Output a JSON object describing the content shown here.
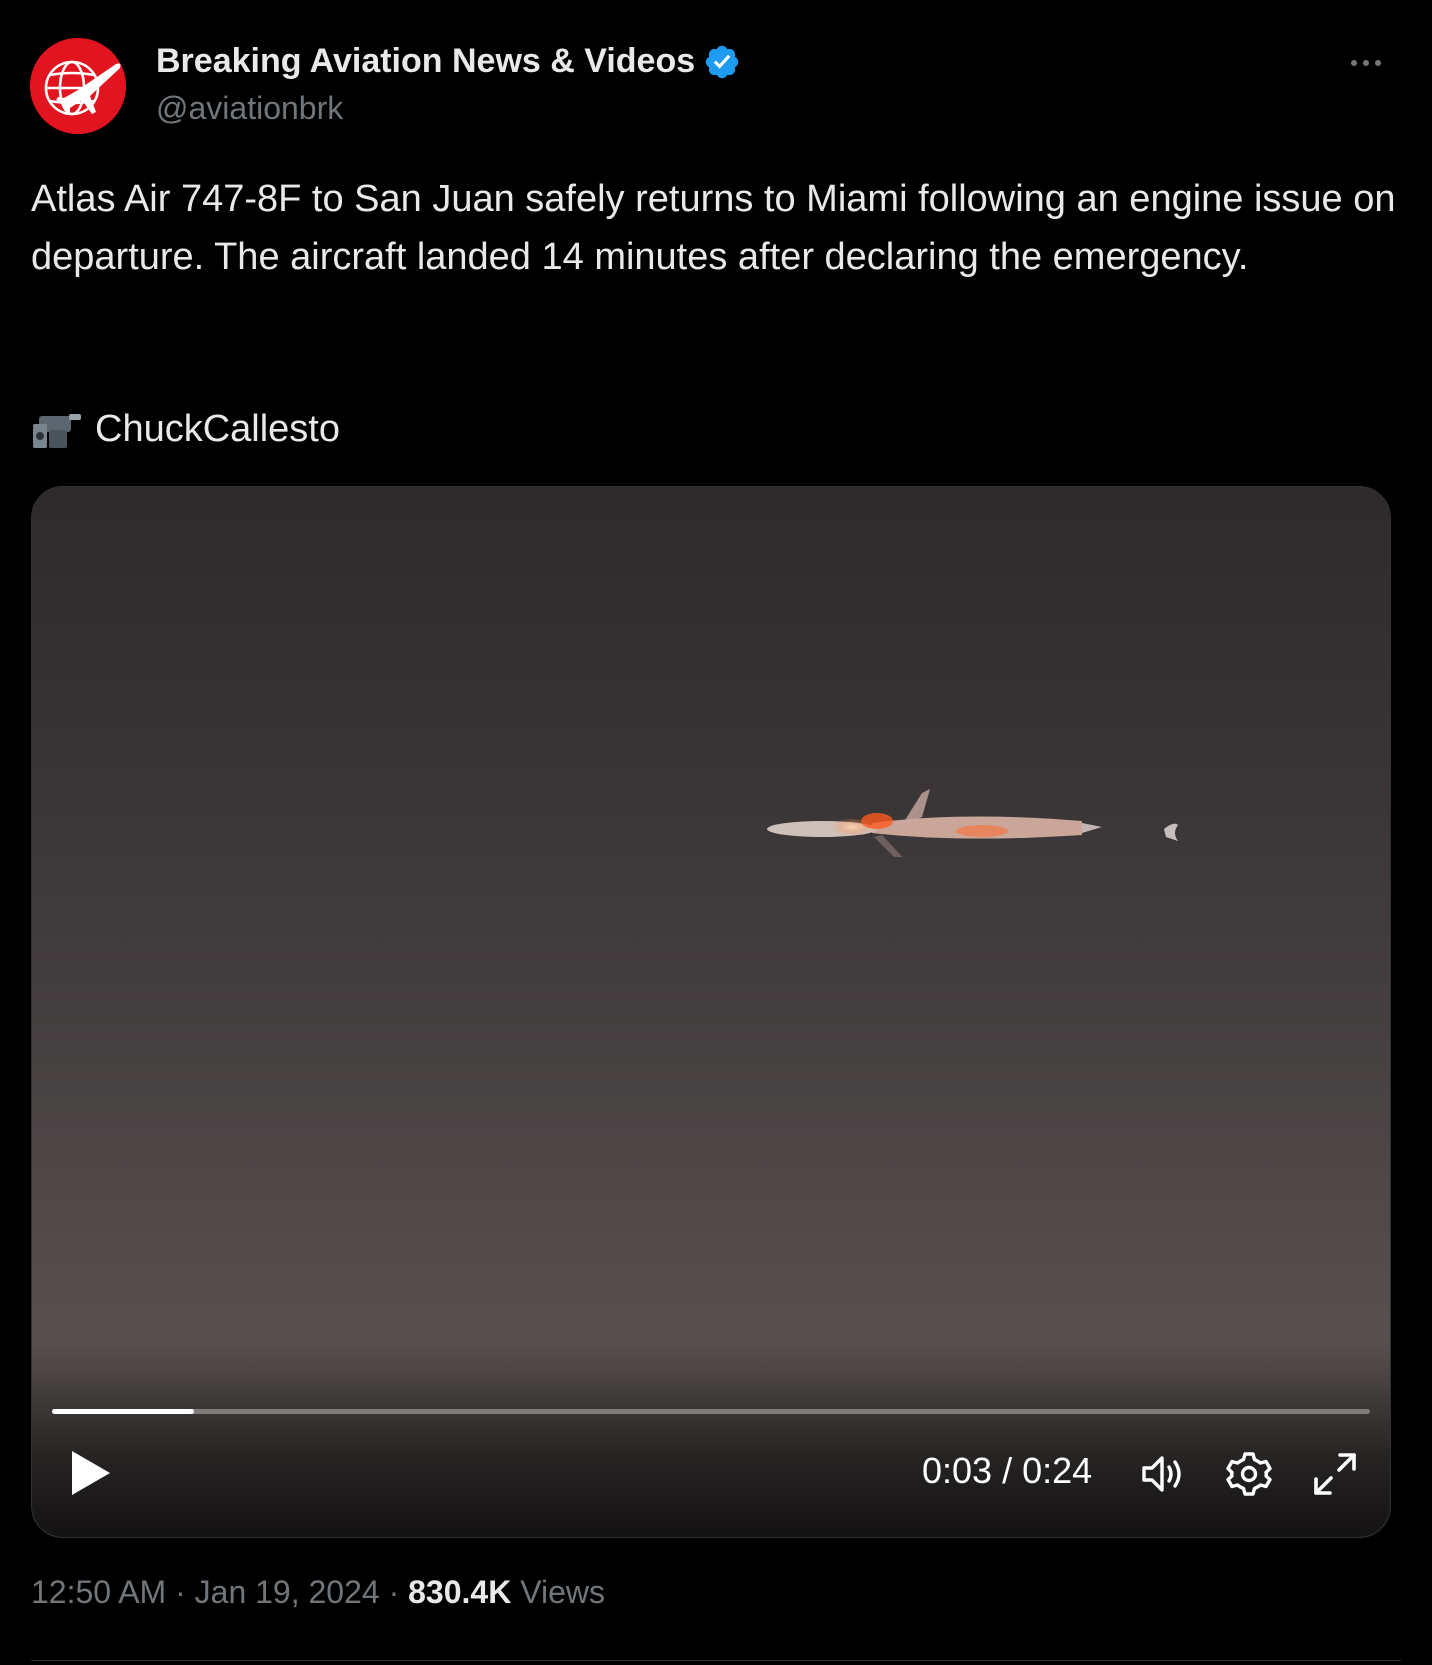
{
  "author": {
    "name": "Breaking Aviation News & Videos",
    "handle": "@aviationbrk",
    "verified": true,
    "avatar_icon": "globe-airplane-logo",
    "avatar_color": "#e1141f",
    "verified_color": "#1d9bf0"
  },
  "menu": {
    "more_icon": "more-horizontal-icon"
  },
  "tweet": {
    "text": "Atlas Air 747-8F to San Juan safely returns to Miami following an engine issue on departure. The aircraft landed 14 minutes after declaring the emergency.",
    "credit_icon": "video-camera-icon",
    "credit_name": "ChuckCallesto"
  },
  "video": {
    "current_time": "0:03",
    "separator": " / ",
    "duration": "0:24",
    "progress_fraction": 0.108,
    "play_icon": "play-icon",
    "volume_icon": "volume-icon",
    "settings_icon": "gear-icon",
    "fullscreen_icon": "fullscreen-expand-icon"
  },
  "meta": {
    "time": "12:50 AM",
    "dot": " · ",
    "date": "Jan 19, 2024",
    "views_count": "830.4K",
    "views_label": " Views"
  },
  "colors": {
    "background": "#000000",
    "text_primary": "#e7e9ea",
    "text_secondary": "#71767b",
    "border": "#2f3336"
  }
}
